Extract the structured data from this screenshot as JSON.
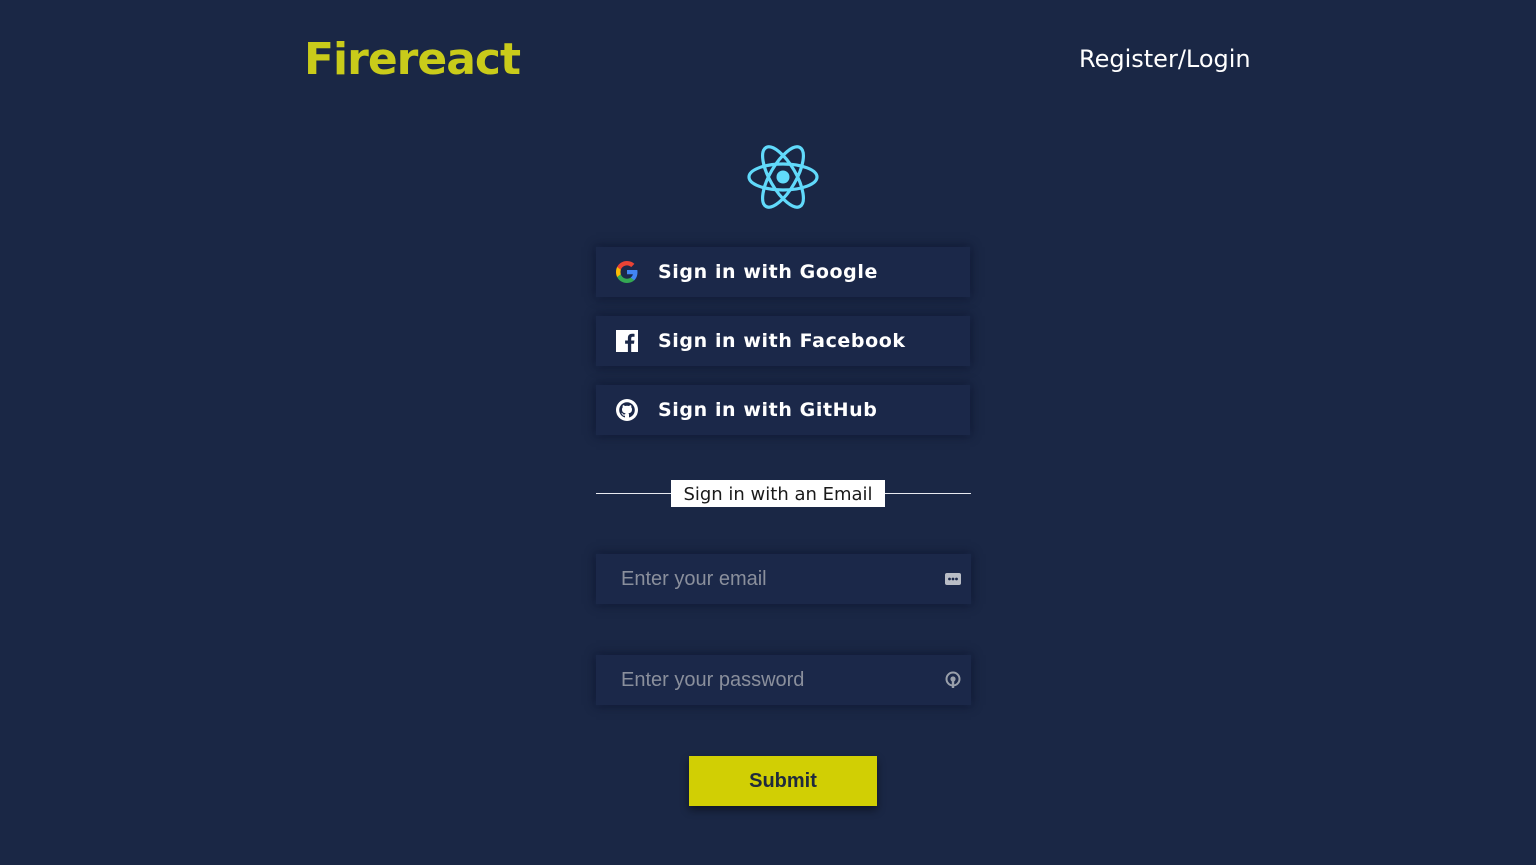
{
  "header": {
    "brand": "Firereact",
    "nav_link": "Register/Login",
    "brand_color": "#c9cb1a"
  },
  "logo": {
    "icon": "react-atom-icon",
    "color": "#61dafb"
  },
  "providers": [
    {
      "label": "Sign in with Google",
      "icon": "google-icon"
    },
    {
      "label": "Sign in with Facebook",
      "icon": "facebook-icon"
    },
    {
      "label": "Sign in with GitHub",
      "icon": "github-icon"
    }
  ],
  "divider": {
    "label": "Sign in with an Email"
  },
  "form": {
    "email_placeholder": "Enter your email",
    "email_value": "",
    "password_placeholder": "Enter your password",
    "password_value": "",
    "submit_label": "Submit",
    "submit_color": "#d1cf04"
  },
  "colors": {
    "background": "#1a2745",
    "panel": "#1b2849"
  }
}
